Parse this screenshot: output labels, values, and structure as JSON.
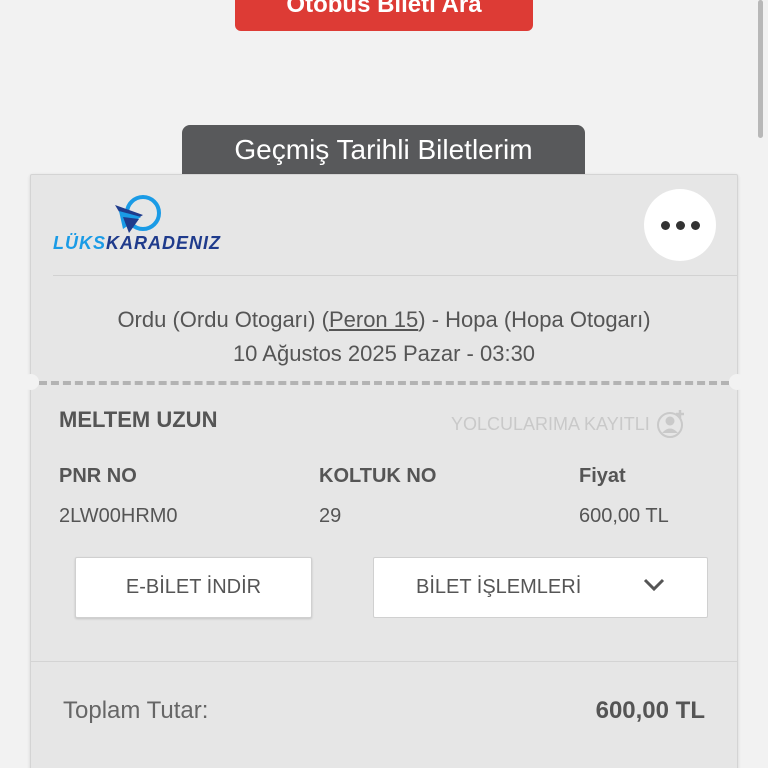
{
  "top": {
    "search_button": "Otobüs Bileti Ara"
  },
  "section": {
    "title": "Geçmiş Tarihli Biletlerim"
  },
  "ticket": {
    "company": {
      "logo_left": "LÜKS",
      "logo_right": "KARADENIZ"
    },
    "route": {
      "from": "Ordu (Ordu Otogarı) (",
      "peron": "Peron 15",
      "to": ") - Hopa (Hopa Otogarı)",
      "datetime": "10 Ağustos 2025 Pazar - 03:30"
    },
    "passenger": {
      "name": "MELTEM UZUN",
      "saved_label": "YOLCULARIMA KAYITLI"
    },
    "columns": {
      "pnr_header": "PNR NO",
      "pnr_value": "2LW00HRM0",
      "seat_header": "KOLTUK NO",
      "seat_value": "29",
      "price_header": "Fiyat",
      "price_value": "600,00 TL"
    },
    "actions": {
      "download": "E-BİLET İNDİR",
      "operations": "BİLET İŞLEMLERİ"
    },
    "total": {
      "label": "Toplam Tutar:",
      "value": "600,00 TL"
    }
  },
  "icons": {
    "more": "more-horizontal-icon",
    "chevron": "chevron-down-icon",
    "user_add": "user-plus-icon",
    "logo_bird": "bird-logo-icon"
  },
  "colors": {
    "search_button": "#dd3b35",
    "section_label": "#58595b",
    "logo_dark": "#1f3b8c",
    "logo_light": "#1a9be6"
  }
}
